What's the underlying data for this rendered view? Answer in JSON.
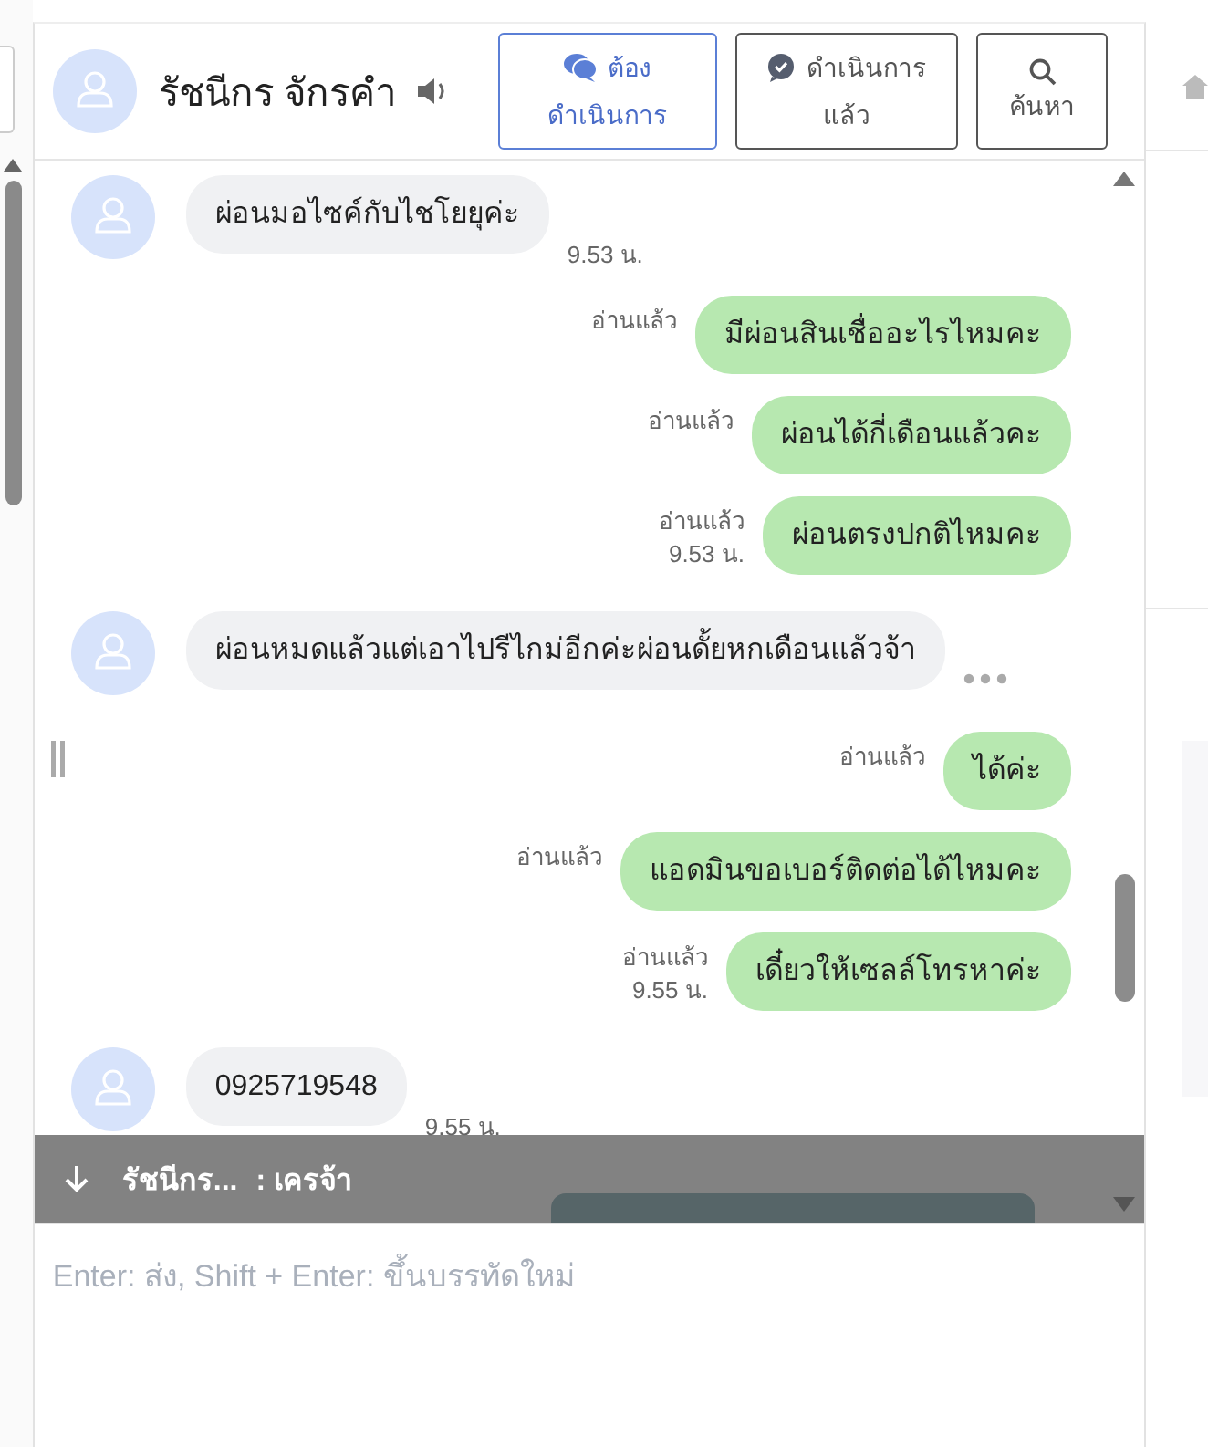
{
  "header": {
    "contact_name": "รัชนีกร จักรคำ",
    "buttons": [
      {
        "kind": "pending",
        "lines": [
          "ต้อง",
          "ดำเนินการ"
        ],
        "selected": true
      },
      {
        "kind": "done",
        "lines": [
          "ดำเนินการ",
          "แล้ว"
        ],
        "selected": false
      },
      {
        "kind": "search",
        "lines": [
          "ค้นหา"
        ],
        "selected": false
      }
    ]
  },
  "messages": [
    {
      "kind": "incoming",
      "text": "ผ่อนมอไซค์กับไชโยยุค่ะ",
      "time": "9.53 น."
    },
    {
      "kind": "outgoing",
      "text": "มีผ่อนสินเชื่ออะไรไหมคะ",
      "read": "อ่านแล้ว"
    },
    {
      "kind": "outgoing",
      "text": "ผ่อนได้กี่เดือนแล้วคะ",
      "read": "อ่านแล้ว"
    },
    {
      "kind": "outgoing",
      "text": "ผ่อนตรงปกติไหมคะ",
      "read": "อ่านแล้ว",
      "time": "9.53 น."
    },
    {
      "kind": "incoming",
      "text": "ผ่อนหมดแล้วแต่เอาไปรีไกม่อีกค่ะผ่อนดั้ยหกเดือนแล้วจ้า",
      "more": true
    },
    {
      "kind": "outgoing",
      "text": "ได้ค่ะ",
      "read": "อ่านแล้ว"
    },
    {
      "kind": "outgoing",
      "text": "แอดมินขอเบอร์ติดต่อได้ไหมคะ",
      "read": "อ่านแล้ว"
    },
    {
      "kind": "outgoing",
      "text": "เดี๋ยวให้เซลล์โทรหาค่ะ",
      "read": "อ่านแล้ว",
      "time": "9.55 น."
    },
    {
      "kind": "incoming",
      "text": "0925719548",
      "time": "9.55 น."
    },
    {
      "kind": "image"
    }
  ],
  "new_message_bar": {
    "sender": "รัชนีกร...",
    "text": ": เครจ้า"
  },
  "composer": {
    "placeholder": "Enter: ส่ง, Shift + Enter: ขึ้นบรรทัดใหม่"
  }
}
